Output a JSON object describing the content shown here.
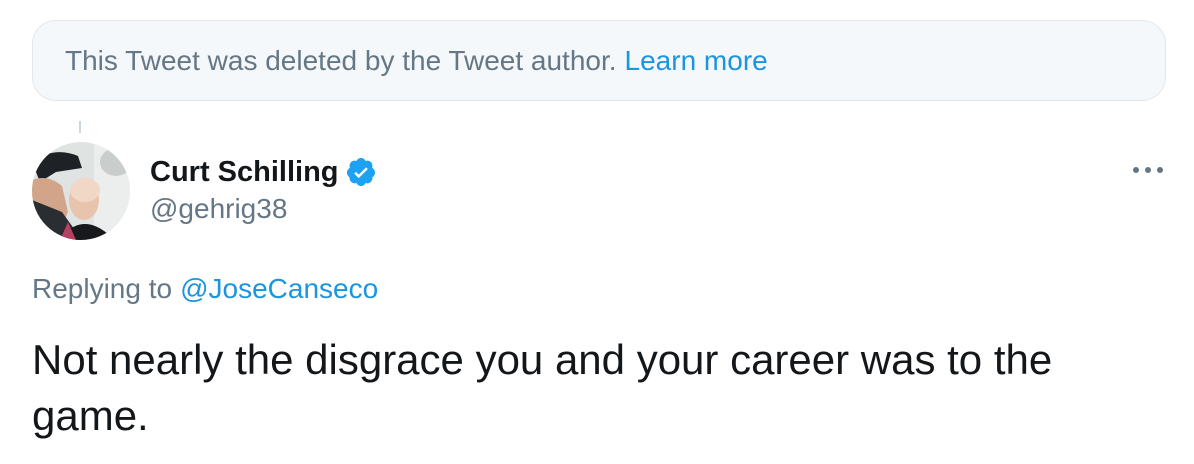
{
  "notice": {
    "text": "This Tweet was deleted by the Tweet author.",
    "link": "Learn more"
  },
  "tweet": {
    "author_name": "Curt Schilling",
    "handle": "@gehrig38",
    "verified": true,
    "replying_prefix": "Replying to",
    "replying_to": "@JoseCanseco",
    "text": "Not nearly the disgrace you and your career was to the game."
  },
  "icons": {
    "verified": "verified-badge-icon",
    "more": "more-options-icon"
  },
  "colors": {
    "link": "#1b95e0",
    "secondary_text": "#657786",
    "notice_background": "#f5f8fa",
    "verified": "#1da1f2"
  }
}
